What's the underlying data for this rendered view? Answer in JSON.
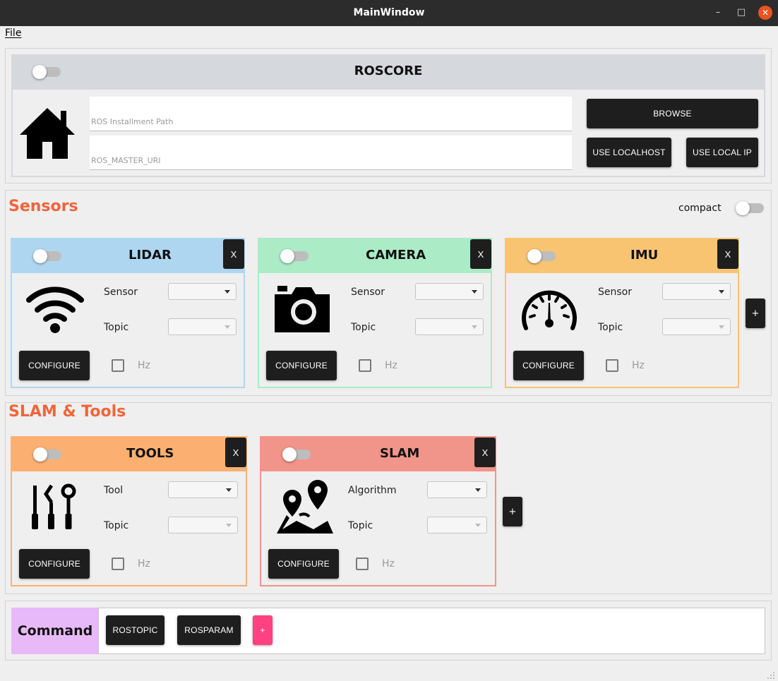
{
  "window": {
    "title": "MainWindow",
    "minimize": "–",
    "maximize": "□",
    "close": "✕"
  },
  "menu": {
    "file": "File"
  },
  "roscore": {
    "title": "ROSCORE",
    "install_path_placeholder": "ROS Installment Path",
    "master_uri_placeholder": "ROS_MASTER_URI",
    "browse_label": "BROWSE",
    "localhost_label": "USE LOCALHOST",
    "localip_label": "USE LOCAL IP"
  },
  "sensors": {
    "title": "Sensors",
    "compact_label": "compact",
    "add_label": "+",
    "cards": [
      {
        "title": "LIDAR",
        "close_label": "X",
        "field1": "Sensor",
        "field2": "Topic",
        "configure_label": "CONFIGURE",
        "hz_label": "Hz",
        "color": "#aed6f1",
        "border": "#aed6f1",
        "icon": "wifi-icon"
      },
      {
        "title": "CAMERA",
        "close_label": "X",
        "field1": "Sensor",
        "field2": "Topic",
        "configure_label": "CONFIGURE",
        "hz_label": "Hz",
        "color": "#abebc6",
        "border": "#abebc6",
        "icon": "camera-icon"
      },
      {
        "title": "IMU",
        "close_label": "X",
        "field1": "Sensor",
        "field2": "Topic",
        "configure_label": "CONFIGURE",
        "hz_label": "Hz",
        "color": "#f8c471",
        "border": "#f8c471",
        "icon": "speedometer-icon"
      }
    ]
  },
  "slam_tools": {
    "title": "SLAM & Tools",
    "add_label": "+",
    "cards": [
      {
        "title": "TOOLS",
        "close_label": "X",
        "field1": "Tool",
        "field2": "Topic",
        "configure_label": "CONFIGURE",
        "hz_label": "Hz",
        "color": "#fbb072",
        "border": "#fbb072",
        "icon": "tools-icon"
      },
      {
        "title": "SLAM",
        "close_label": "X",
        "field1": "Algorithm",
        "field2": "Topic",
        "configure_label": "CONFIGURE",
        "hz_label": "Hz",
        "color": "#f1948a",
        "border": "#f1948a",
        "icon": "map-pin-icon"
      }
    ]
  },
  "command": {
    "title": "Command",
    "rostopic_label": "ROSTOPIC",
    "rosparam_label": "ROSPARAM",
    "add_label": "+",
    "title_color": "#e8b9f8",
    "add_color": "#ff4081"
  }
}
